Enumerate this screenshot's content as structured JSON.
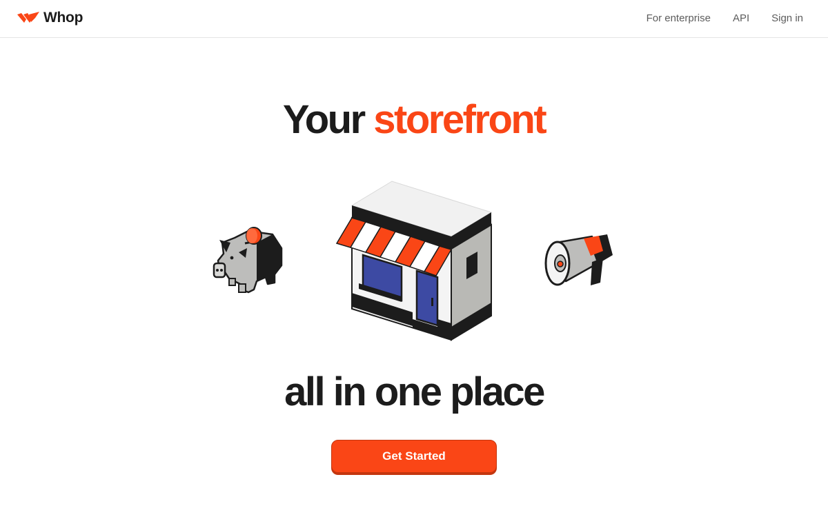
{
  "brand": {
    "name": "Whop",
    "accent_color": "#fa4616",
    "text_color": "#1c1c1c"
  },
  "header": {
    "logo_icon": "whop-logo-icon",
    "nav": [
      {
        "label": "For enterprise"
      },
      {
        "label": "API"
      },
      {
        "label": "Sign in"
      }
    ]
  },
  "hero": {
    "headline_prefix": "Your",
    "headline_accent": "storefront",
    "headline_suffix": "all in one place",
    "illustrations": [
      "piggy-bank-icon",
      "storefront-icon",
      "megaphone-icon"
    ],
    "cta_label": "Get Started"
  }
}
